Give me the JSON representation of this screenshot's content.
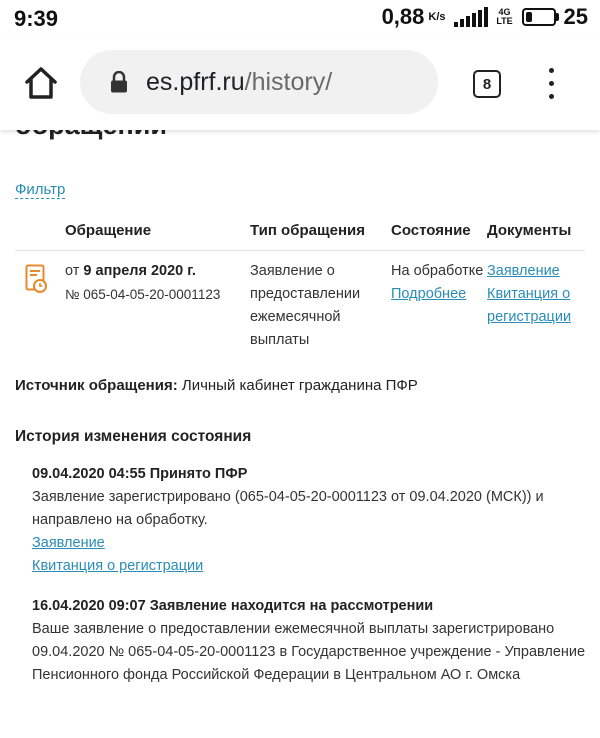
{
  "status_bar": {
    "time": "9:39",
    "speed": "0,88",
    "speed_unit": "K/s",
    "network": "4G LTE",
    "battery_level": "25",
    "battery_fraction": 0.25
  },
  "browser": {
    "url_domain": "es.pfrf.ru",
    "url_path": "/history/",
    "tab_count": "8",
    "icons": {
      "home": "home-icon",
      "lock": "lock-icon",
      "menu": "more-vert-icon"
    }
  },
  "page": {
    "heading": "обращений",
    "filter_label": "Фильтр",
    "table": {
      "headers": [
        "Обращение",
        "Тип обращения",
        "Состояние",
        "Документы"
      ],
      "row": {
        "date_prefix": "от ",
        "date": "9 апреля 2020 г.",
        "number": "№ 065-04-05-20-0001123",
        "type": "Заявление о предоставлении ежемесячной выплаты",
        "status": "На обработке",
        "status_link": "Подробнее",
        "documents": [
          "Заявление",
          "Квитанция о регистрации"
        ]
      }
    },
    "source_label": "Источник обращения:",
    "source_value": " Личный кабинет гражданина ПФР",
    "history_title": "История изменения состояния",
    "history": [
      {
        "title": "09.04.2020 04:55 Принято ПФР",
        "text": "Заявление зарегистрировано (065-04-05-20-0001123 от 09.04.2020 (МСК)) и направлено на обработку.",
        "links": [
          "Заявление",
          "Квитанция о регистрации"
        ]
      },
      {
        "title": "16.04.2020 09:07 Заявление находится на рассмотрении",
        "text": "Ваше заявление о предоставлении ежемесячной выплаты зарегистрировано 09.04.2020 № 065-04-05-20-0001123 в Государственное учреждение - Управление Пенсионного фонда Российской Федерации в Центральном АО г. Омска"
      }
    ]
  },
  "colors": {
    "link": "#2a8cb8",
    "icon_accent": "#e8892b"
  }
}
